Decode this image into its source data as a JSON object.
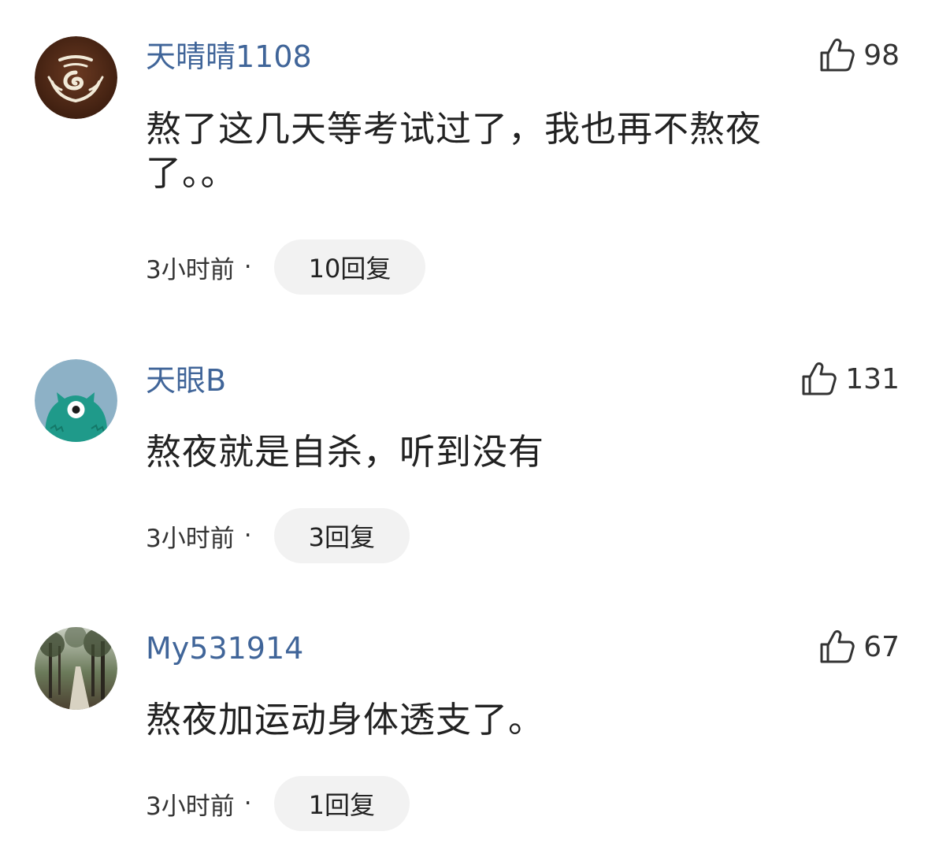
{
  "comments": [
    {
      "username": "天晴晴1108",
      "likes": "98",
      "text": "熬了这几天等考试过了，我也再不熬夜了。。",
      "time": "3小时前",
      "separator": "·",
      "replies": "10回复",
      "avatar_icon": "swirl-logo-avatar"
    },
    {
      "username": "天眼B",
      "likes": "131",
      "text": "熬夜就是自杀，听到没有",
      "time": "3小时前",
      "separator": "·",
      "replies": "3回复",
      "avatar_icon": "one-eyed-monster-avatar"
    },
    {
      "username": "My531914",
      "likes": "67",
      "text": "熬夜加运动身体透支了。",
      "time": "3小时前",
      "separator": "·",
      "replies": "1回复",
      "avatar_icon": "forest-path-avatar"
    }
  ],
  "colors": {
    "username": "#406599",
    "reply_bg": "#f2f2f2",
    "text": "#222222"
  },
  "like_icon": "thumbs-up-icon"
}
